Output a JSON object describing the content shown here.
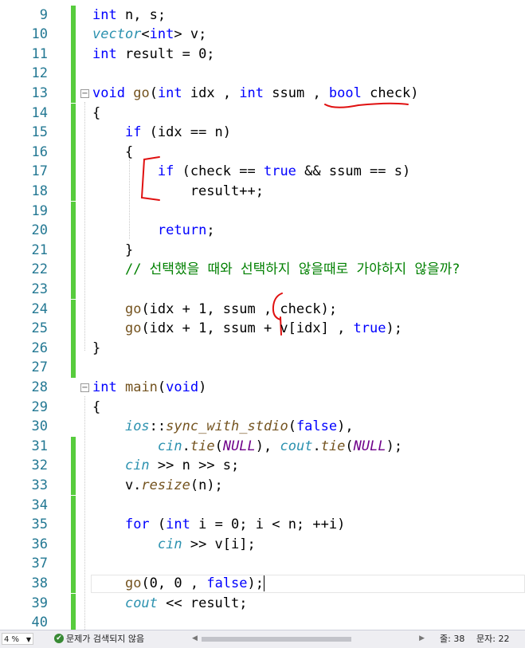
{
  "editor": {
    "lines": [
      {
        "n": "9",
        "tokens": [
          {
            "t": "int",
            "c": "kw"
          },
          {
            "t": " n, s;"
          }
        ]
      },
      {
        "n": "10",
        "tokens": [
          {
            "t": "vector",
            "c": "ty it"
          },
          {
            "t": "<"
          },
          {
            "t": "int",
            "c": "kw"
          },
          {
            "t": "> v;"
          }
        ]
      },
      {
        "n": "11",
        "tokens": [
          {
            "t": "int",
            "c": "kw"
          },
          {
            "t": " result = 0;"
          }
        ]
      },
      {
        "n": "12",
        "tokens": []
      },
      {
        "n": "13",
        "tokens": [
          {
            "t": "void",
            "c": "kw"
          },
          {
            "t": " "
          },
          {
            "t": "go",
            "c": "fn"
          },
          {
            "t": "("
          },
          {
            "t": "int",
            "c": "kw"
          },
          {
            "t": " idx , "
          },
          {
            "t": "int",
            "c": "kw"
          },
          {
            "t": " ssum , "
          },
          {
            "t": "bool",
            "c": "kw"
          },
          {
            "t": " check)"
          }
        ]
      },
      {
        "n": "14",
        "tokens": [
          {
            "t": "{"
          }
        ]
      },
      {
        "n": "15",
        "tokens": [
          {
            "t": "    "
          },
          {
            "t": "if",
            "c": "kw"
          },
          {
            "t": " (idx == n)"
          }
        ]
      },
      {
        "n": "16",
        "tokens": [
          {
            "t": "    {"
          }
        ]
      },
      {
        "n": "17",
        "tokens": [
          {
            "t": "        "
          },
          {
            "t": "if",
            "c": "kw"
          },
          {
            "t": " (check == "
          },
          {
            "t": "true",
            "c": "kw"
          },
          {
            "t": " && ssum == s)"
          }
        ]
      },
      {
        "n": "18",
        "tokens": [
          {
            "t": "            result++;"
          }
        ]
      },
      {
        "n": "19",
        "tokens": []
      },
      {
        "n": "20",
        "tokens": [
          {
            "t": "        "
          },
          {
            "t": "return",
            "c": "kw"
          },
          {
            "t": ";"
          }
        ]
      },
      {
        "n": "21",
        "tokens": [
          {
            "t": "    }"
          }
        ]
      },
      {
        "n": "22",
        "tokens": [
          {
            "t": "    "
          },
          {
            "t": "// 선택했을 때와 선택하지 않을때로 가야하지 않을까?",
            "c": "cm"
          }
        ]
      },
      {
        "n": "23",
        "tokens": []
      },
      {
        "n": "24",
        "tokens": [
          {
            "t": "    "
          },
          {
            "t": "go",
            "c": "fn"
          },
          {
            "t": "(idx + 1, ssum , check);"
          }
        ]
      },
      {
        "n": "25",
        "tokens": [
          {
            "t": "    "
          },
          {
            "t": "go",
            "c": "fn"
          },
          {
            "t": "(idx + 1, ssum + v[idx] , "
          },
          {
            "t": "true",
            "c": "kw"
          },
          {
            "t": ");"
          }
        ]
      },
      {
        "n": "26",
        "tokens": [
          {
            "t": "}"
          }
        ]
      },
      {
        "n": "27",
        "tokens": []
      },
      {
        "n": "28",
        "tokens": [
          {
            "t": "int",
            "c": "kw"
          },
          {
            "t": " "
          },
          {
            "t": "main",
            "c": "fn"
          },
          {
            "t": "("
          },
          {
            "t": "void",
            "c": "kw"
          },
          {
            "t": ")"
          }
        ]
      },
      {
        "n": "29",
        "tokens": [
          {
            "t": "{"
          }
        ]
      },
      {
        "n": "30",
        "tokens": [
          {
            "t": "    "
          },
          {
            "t": "ios",
            "c": "ty it"
          },
          {
            "t": "::"
          },
          {
            "t": "sync_with_stdio",
            "c": "fn it"
          },
          {
            "t": "("
          },
          {
            "t": "false",
            "c": "kw"
          },
          {
            "t": "),"
          }
        ]
      },
      {
        "n": "31",
        "tokens": [
          {
            "t": "        "
          },
          {
            "t": "cin",
            "c": "ty it"
          },
          {
            "t": "."
          },
          {
            "t": "tie",
            "c": "fn it"
          },
          {
            "t": "("
          },
          {
            "t": "NULL",
            "c": "mac"
          },
          {
            "t": "), "
          },
          {
            "t": "cout",
            "c": "ty it"
          },
          {
            "t": "."
          },
          {
            "t": "tie",
            "c": "fn it"
          },
          {
            "t": "("
          },
          {
            "t": "NULL",
            "c": "mac"
          },
          {
            "t": ");"
          }
        ]
      },
      {
        "n": "32",
        "tokens": [
          {
            "t": "    "
          },
          {
            "t": "cin",
            "c": "ty it"
          },
          {
            "t": " >> n >> s;"
          }
        ]
      },
      {
        "n": "33",
        "tokens": [
          {
            "t": "    v."
          },
          {
            "t": "resize",
            "c": "fn it"
          },
          {
            "t": "(n);"
          }
        ]
      },
      {
        "n": "34",
        "tokens": []
      },
      {
        "n": "35",
        "tokens": [
          {
            "t": "    "
          },
          {
            "t": "for",
            "c": "kw"
          },
          {
            "t": " ("
          },
          {
            "t": "int",
            "c": "kw"
          },
          {
            "t": " i = 0; i < n; ++i)"
          }
        ]
      },
      {
        "n": "36",
        "tokens": [
          {
            "t": "        "
          },
          {
            "t": "cin",
            "c": "ty it"
          },
          {
            "t": " >> v[i];"
          }
        ]
      },
      {
        "n": "37",
        "tokens": []
      },
      {
        "n": "38",
        "tokens": [
          {
            "t": "    "
          },
          {
            "t": "go",
            "c": "fn"
          },
          {
            "t": "(0, 0 , "
          },
          {
            "t": "false",
            "c": "kw"
          },
          {
            "t": ");"
          }
        ]
      },
      {
        "n": "39",
        "tokens": [
          {
            "t": "    "
          },
          {
            "t": "cout",
            "c": "ty it"
          },
          {
            "t": " << result;"
          }
        ]
      },
      {
        "n": "40",
        "tokens": []
      }
    ],
    "changed_lines": [
      "9",
      "10",
      "11",
      "12",
      "13",
      "14",
      "15",
      "16",
      "17",
      "18",
      "19",
      "20",
      "21",
      "22",
      "23",
      "24",
      "25",
      "26",
      "27",
      "31",
      "32",
      "33",
      "34",
      "35",
      "36",
      "37",
      "38",
      "39",
      "40"
    ],
    "fold_lines": [
      "13",
      "28"
    ],
    "current_line": "38"
  },
  "statusbar": {
    "zoom": "4 %",
    "issues_text": "문제가 검색되지 않음",
    "line_label": "줄: 38",
    "col_label": "문자: 22"
  },
  "colors": {
    "keyword": "#0000ff",
    "comment": "#008000",
    "function": "#74531f",
    "type": "#2b91af",
    "macro": "#6f008a",
    "line_number": "#237893",
    "change_bar": "#57cc3d",
    "annotation_ink": "#e01010"
  }
}
